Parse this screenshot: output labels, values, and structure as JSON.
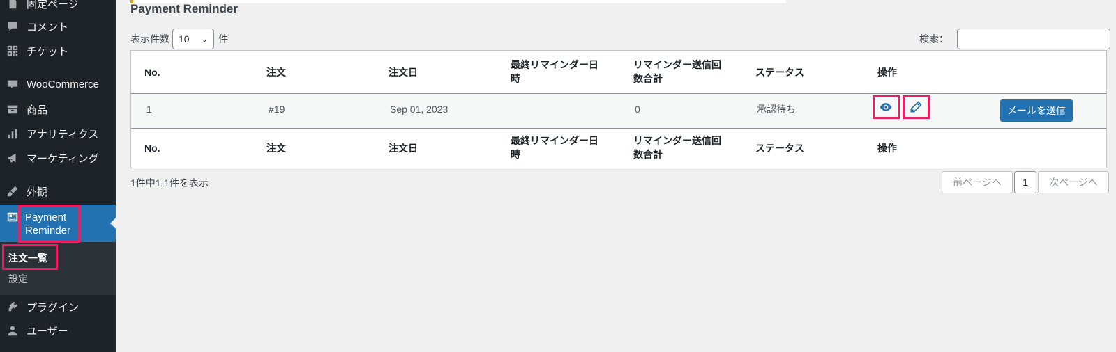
{
  "sidebar": {
    "items": [
      {
        "label": "固定ページ",
        "icon": "page-icon"
      },
      {
        "label": "コメント",
        "icon": "comment-icon"
      },
      {
        "label": "チケット",
        "icon": "qr-icon"
      },
      {
        "label": "WooCommerce",
        "icon": "woo-icon"
      },
      {
        "label": "商品",
        "icon": "archive-icon"
      },
      {
        "label": "アナリティクス",
        "icon": "bar-chart-icon"
      },
      {
        "label": "マーケティング",
        "icon": "megaphone-icon"
      },
      {
        "label": "外観",
        "icon": "paintbrush-icon"
      },
      {
        "label": "プラグイン",
        "icon": "plugin-icon"
      },
      {
        "label": "ユーザー",
        "icon": "user-icon"
      }
    ],
    "active": {
      "label": "Payment Reminder",
      "icon": "payment-reminder-icon"
    },
    "submenu": [
      {
        "label": "注文一覧",
        "current": true
      },
      {
        "label": "設定",
        "current": false
      }
    ]
  },
  "page": {
    "title": "Payment Reminder",
    "length_prefix": "表示件数",
    "length_value": "10",
    "length_suffix": "件",
    "search_label": "検索："
  },
  "table": {
    "columns": [
      "No.",
      "注文",
      "注文日",
      "最終リマインダー日時",
      "リマインダー送信回数合計",
      "ステータス",
      "操作"
    ],
    "columns_wrapped": {
      "last_reminder": [
        "最終リマインダー日",
        "時"
      ],
      "total_sent": [
        "リマインダー送信回",
        "数合計"
      ]
    },
    "rows": [
      {
        "no": "1",
        "order": "#19",
        "date": "Sep 01, 2023",
        "last_reminder": "",
        "total": "0",
        "status": "承認待ち",
        "send_label": "メールを送信"
      }
    ]
  },
  "pagination": {
    "info": "1件中1-1件を表示",
    "prev": "前ページへ",
    "current": "1",
    "next": "次ページへ"
  },
  "colors": {
    "sidebar_bg": "#1d2327",
    "active": "#2271b1",
    "highlight": "#e91e63"
  }
}
